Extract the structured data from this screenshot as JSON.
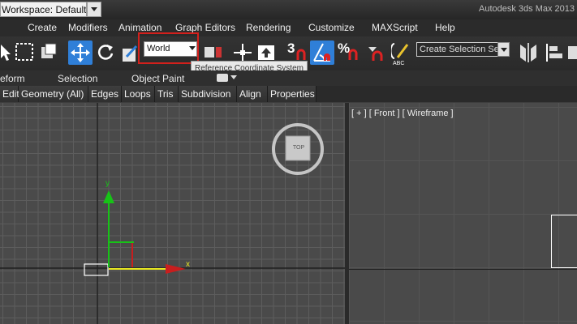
{
  "window": {
    "workspace_label": "Workspace: Default",
    "app_title": "Autodesk 3ds Max 2013"
  },
  "menubar": {
    "items": [
      "Create",
      "Modifiers",
      "Animation",
      "Graph Editors",
      "Rendering",
      "Customize",
      "MAXScript",
      "Help"
    ]
  },
  "toolbar": {
    "reference_coordinate_system": "World",
    "tooltip": "Reference Coordinate System",
    "snap_toggle_label": "3",
    "percent_snap_label": "%",
    "named_selection_placeholder": "Create Selection Se",
    "accent_color": "#2f7fd8",
    "highlight_color": "#d2201c"
  },
  "ribbon": {
    "tabs": [
      "eform",
      "Selection",
      "Object Paint"
    ]
  },
  "subbar": {
    "buttons": [
      "Edit",
      "Geometry (All)",
      "Edges",
      "Loops",
      "Tris",
      "Subdivision",
      "Align",
      "Properties"
    ]
  },
  "viewports": {
    "top": {
      "viewcube_label": "TOP",
      "axis_x": "x",
      "axis_y": "y"
    },
    "front": {
      "label": "[ + ] [ Front ] [ Wireframe ]"
    }
  }
}
